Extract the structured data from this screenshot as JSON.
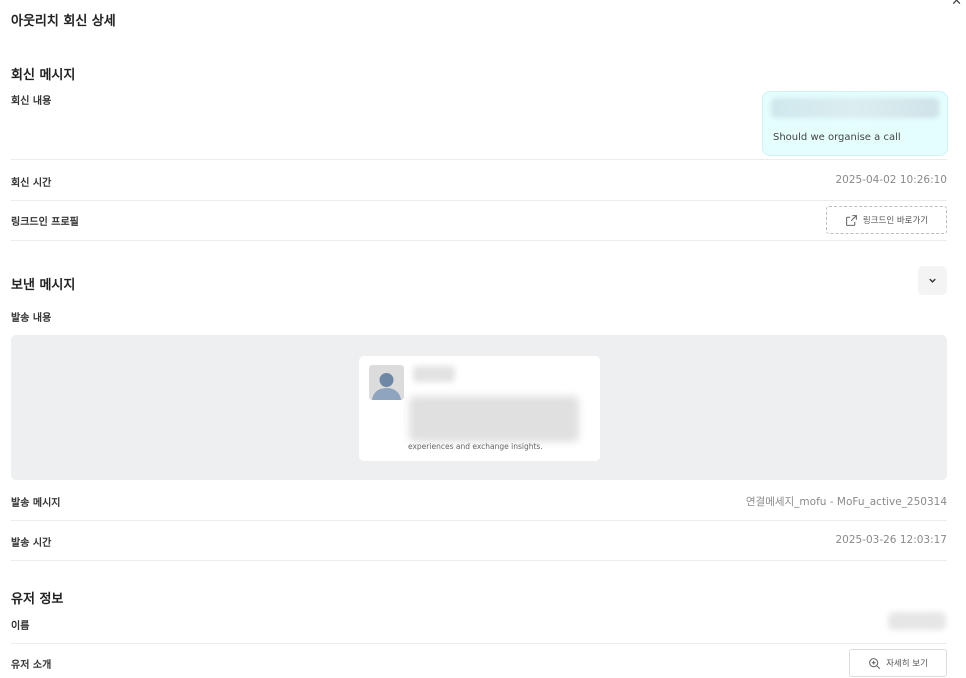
{
  "header": {
    "title": "아웃리치 회신 상세"
  },
  "reply_section": {
    "title": "회신 메시지",
    "content_label": "회신 내용",
    "content_text": "Should we organise a call",
    "time_label": "회신 시간",
    "time_value": "2025-04-02 10:26:10",
    "profile_label": "링크드인 프로필",
    "profile_button": "링크드인 바로가기"
  },
  "sent_section": {
    "title": "보낸 메시지",
    "content_label": "발송 내용",
    "preview_text": "experiences and exchange insights.",
    "message_label": "발송 메시지",
    "message_value": "연결메세지_mofu - MoFu_active_250314",
    "time_label": "발송 시간",
    "time_value": "2025-03-26 12:03:17"
  },
  "user_section": {
    "title": "유저 정보",
    "name_label": "이름",
    "intro_label": "유저 소개",
    "detail_button": "자세히 보기"
  },
  "colors": {
    "bubble_bg": "#e4fdfd",
    "preview_bg": "#eeeff1",
    "text_muted": "#8a8a8a"
  }
}
